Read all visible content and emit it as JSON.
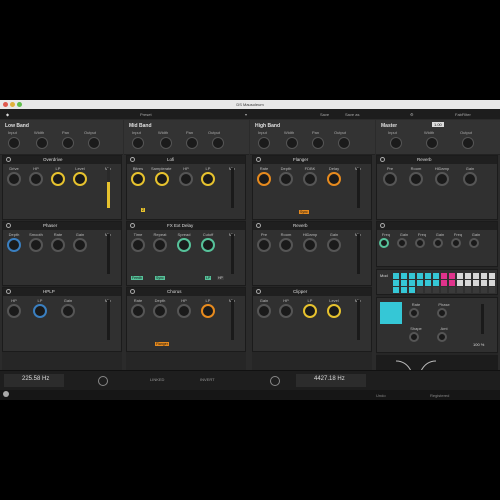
{
  "window": {
    "title": "DS Mausoleum"
  },
  "toolbar": {
    "preset_label": "Preset",
    "save_label": "Save",
    "saveas_label": "Save as",
    "brand": "FabFilter"
  },
  "sections": [
    {
      "name": "Low Band",
      "controls": [
        "Input",
        "Width",
        "Pan",
        "Output"
      ]
    },
    {
      "name": "Mid Band",
      "controls": [
        "Input",
        "Width",
        "Pan",
        "Output"
      ]
    },
    {
      "name": "High Band",
      "controls": [
        "Input",
        "Width",
        "Pan",
        "Output"
      ]
    },
    {
      "name": "Master",
      "controls": [
        "Input",
        "Width",
        "Output"
      ],
      "badge": "1.00"
    }
  ],
  "modules": {
    "low": [
      {
        "name": "Overdrive",
        "params": [
          "Drive",
          "HP",
          "LP",
          "Level",
          "Mix"
        ]
      },
      {
        "name": "Phaser",
        "params": [
          "Depth",
          "Smooth",
          "Rate",
          "Gain",
          "Mix"
        ]
      },
      {
        "name": "HPLP",
        "params": [
          "HP",
          "LP",
          "Gain",
          "Mix"
        ]
      }
    ],
    "mid": [
      {
        "name": "Lofi",
        "params": [
          "Bitres",
          "Samplerate",
          "HP",
          "LP",
          "Mix"
        ],
        "tags": [
          "Z"
        ]
      },
      {
        "name": "FX Ext Delay",
        "params": [
          "Time",
          "Repeat",
          "Spread",
          "Cutoff",
          "Mix"
        ],
        "tags": [
          "Feedb",
          "Sync",
          "LP",
          "HP"
        ]
      },
      {
        "name": "Chorus",
        "params": [
          "Rate",
          "Depth",
          "HP",
          "LP",
          "Mix"
        ],
        "tags": [
          "Flanger"
        ]
      }
    ],
    "high": [
      {
        "name": "Flanger",
        "params": [
          "Rate",
          "Depth",
          "FDBK",
          "Delay",
          "Mix"
        ],
        "tags": [
          "Sync"
        ]
      },
      {
        "name": "Reverb",
        "params": [
          "Pre",
          "Room",
          "HiDamp",
          "Gain",
          "Mix"
        ]
      },
      {
        "name": "Clipper",
        "params": [
          "Gain",
          "HP",
          "LP",
          "Level",
          "Mix"
        ]
      }
    ],
    "master": [
      {
        "name": "Reverb",
        "params": [
          "Pre",
          "Room",
          "HiDamp",
          "Gain"
        ]
      },
      {
        "name": "EQ",
        "params": [
          "Freq",
          "Gain",
          "Freq",
          "Gain",
          "Freq",
          "Gain"
        ]
      }
    ]
  },
  "mod": {
    "label": "Mod",
    "mix_pct": "100 %",
    "shape_labels": [
      "Rate",
      "Phase",
      "Shape",
      "Amt"
    ]
  },
  "footer": {
    "low_freq": "225.58 Hz",
    "high_freq": "4427.18 Hz",
    "x_label_1": "LINKED",
    "x_label_2": "INVERT"
  },
  "status": {
    "left": "Undo",
    "right": "Registered"
  },
  "colors": {
    "yellow": "#e6c22e",
    "orange": "#e68a1e",
    "green": "#56c29a",
    "cyan": "#35c7d6",
    "magenta": "#e0338c"
  }
}
